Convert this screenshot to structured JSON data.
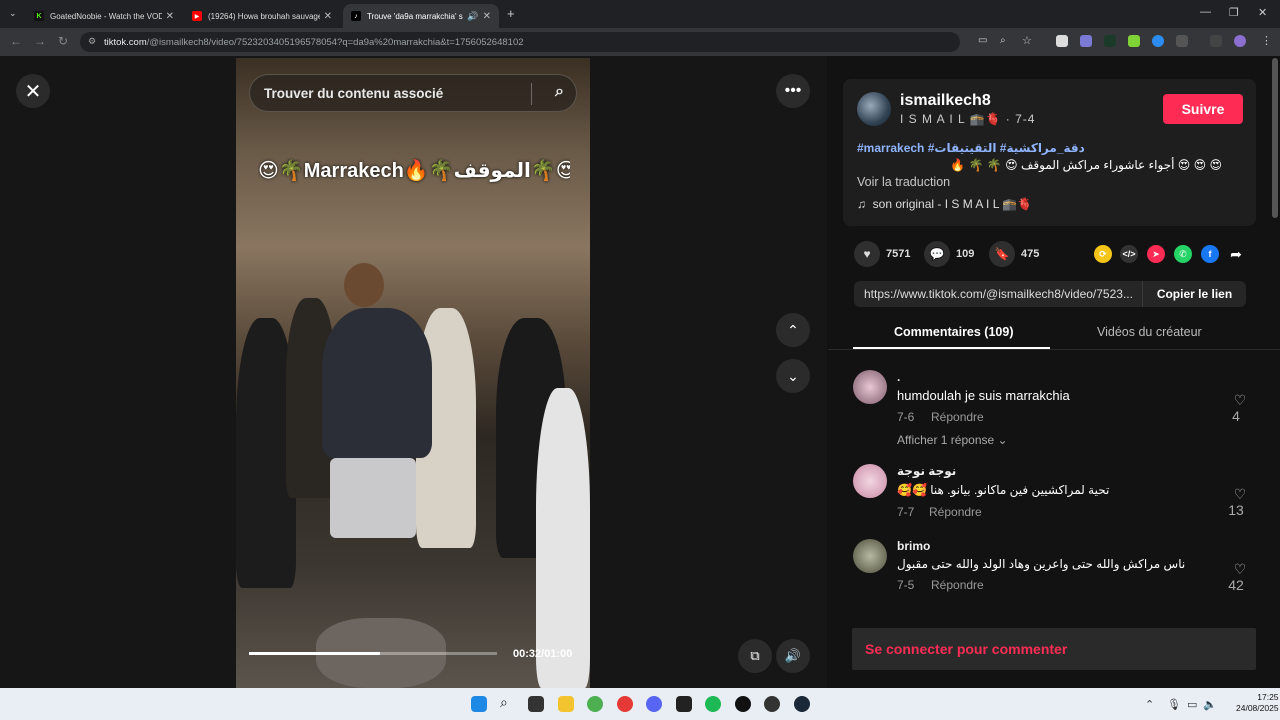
{
  "browser": {
    "tabs": [
      {
        "title": "GoatedNoobie - Watch the VOD",
        "favicon": "K",
        "active": false
      },
      {
        "title": "(19264) Howa brouhah sauvage",
        "favicon": "▶",
        "active": false
      },
      {
        "title": "Trouve 'da9a marrakchia' su",
        "favicon": "♪",
        "active": true
      }
    ],
    "url_host": "tiktok.com",
    "url_path": "/@ismailkech8/video/7523203405196578054?q=da9a%20marrakchia&t=1756052648102"
  },
  "player": {
    "search_placeholder": "Trouver du contenu associé",
    "overlay_text": "😍🌴Marrakech🔥🌴الموقف🌴😍",
    "time": "00:32/01:00",
    "progress_fraction": 0.53
  },
  "video_info": {
    "username": "ismailkech8",
    "nickname": "I S M A I L 🕋🫀 · 7-4",
    "follow_label": "Suivre",
    "hashtags": "#marrakech #دقة_مراكشية# التقيتيقات",
    "description": "😍 😍 😍 أجواء عاشوراء مراكش الموقف 😍 🌴 🌴 🔥",
    "translate_label": "Voir la traduction",
    "music": "son original - I S M A I L 🕋🫀"
  },
  "stats": {
    "likes": "7571",
    "comments": "109",
    "saves": "475"
  },
  "share": {
    "link": "https://www.tiktok.com/@ismailkech8/video/7523...",
    "copy_label": "Copier le lien"
  },
  "tabs": {
    "comments": "Commentaires (109)",
    "creator_videos": "Vidéos du créateur"
  },
  "comments": [
    {
      "name": ".",
      "text": "humdoulah je suis marrakchia",
      "date": "7-6",
      "reply": "Répondre",
      "likes": "4"
    },
    {
      "name": "نوجة نوجة",
      "text": "تحية لمراكشيين فين ماكانو. بيانو. هنا 🥰🥰",
      "date": "7-7",
      "reply": "Répondre",
      "likes": "13"
    },
    {
      "name": "brimo",
      "text": "ناس مراكش والله حتى واعرين وهاد الولد والله حتى مقبول",
      "date": "7-5",
      "reply": "Répondre",
      "likes": "42"
    }
  ],
  "show_replies": "Afficher 1 réponse",
  "login_prompt": "Se connecter pour commenter",
  "clock": {
    "time": "17:25",
    "date": "24/08/2025"
  },
  "colors": {
    "accent": "#fe2c55",
    "hashtag": "#8fb4ff"
  }
}
